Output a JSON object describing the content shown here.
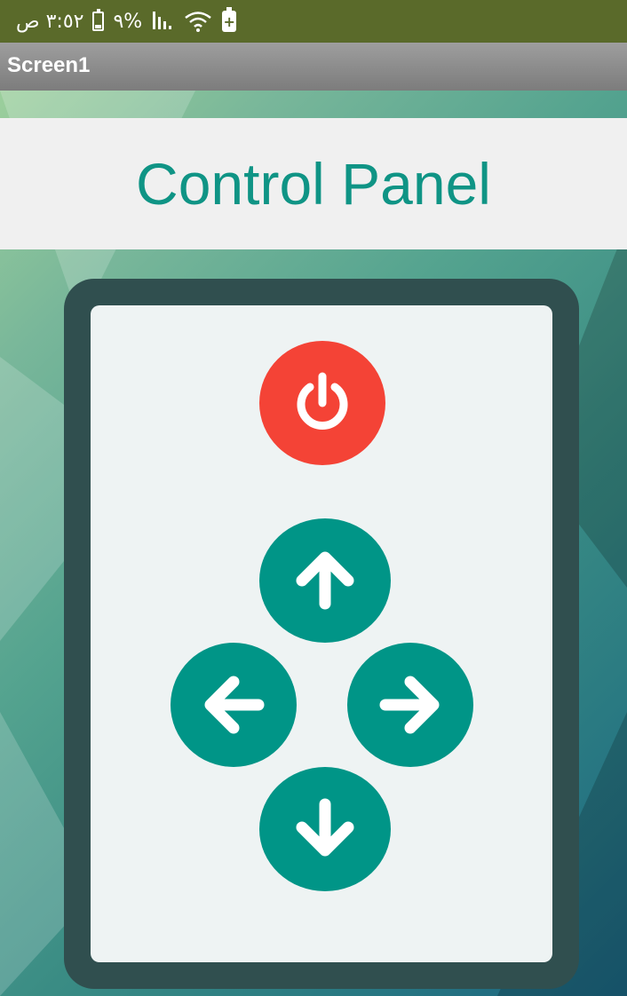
{
  "status_bar": {
    "time": "٣:٥٢ ص",
    "battery_percent": "%٩",
    "icons": [
      "battery-icon",
      "signal-icon",
      "wifi-icon",
      "battery-saver-icon"
    ]
  },
  "title_bar": {
    "title": "Screen1"
  },
  "header": {
    "title": "Control Panel",
    "color": "#0f9485"
  },
  "remote": {
    "frame_color": "#304f4f",
    "panel_color": "#eef3f3",
    "buttons": [
      {
        "name": "power-button",
        "icon": "power-icon",
        "color": "#f44336"
      },
      {
        "name": "up-button",
        "icon": "arrow-up-icon",
        "color": "#009587"
      },
      {
        "name": "left-button",
        "icon": "arrow-left-icon",
        "color": "#009587"
      },
      {
        "name": "right-button",
        "icon": "arrow-right-icon",
        "color": "#009587"
      },
      {
        "name": "down-button",
        "icon": "arrow-down-icon",
        "color": "#009587"
      }
    ]
  }
}
